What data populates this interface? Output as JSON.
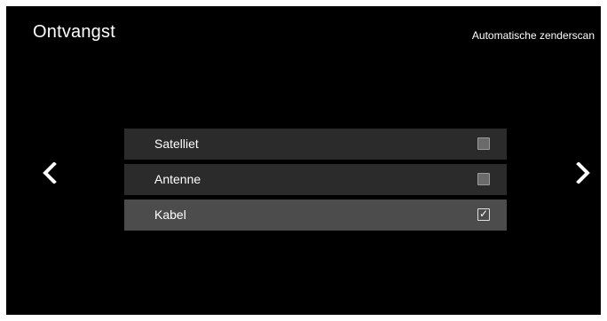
{
  "header": {
    "title": "Ontvangst",
    "subtitle": "Automatische zenderscan"
  },
  "nav": {
    "prev_icon": "chevron-left-icon",
    "next_icon": "chevron-right-icon"
  },
  "options": [
    {
      "label": "Satelliet",
      "checked": false,
      "selected": false
    },
    {
      "label": "Antenne",
      "checked": false,
      "selected": false
    },
    {
      "label": "Kabel",
      "checked": true,
      "selected": true,
      "check_glyph": "✓"
    }
  ],
  "colors": {
    "background": "#000000",
    "row": "#2b2b2b",
    "row_selected": "#4c4c4c",
    "text": "#ffffff"
  }
}
